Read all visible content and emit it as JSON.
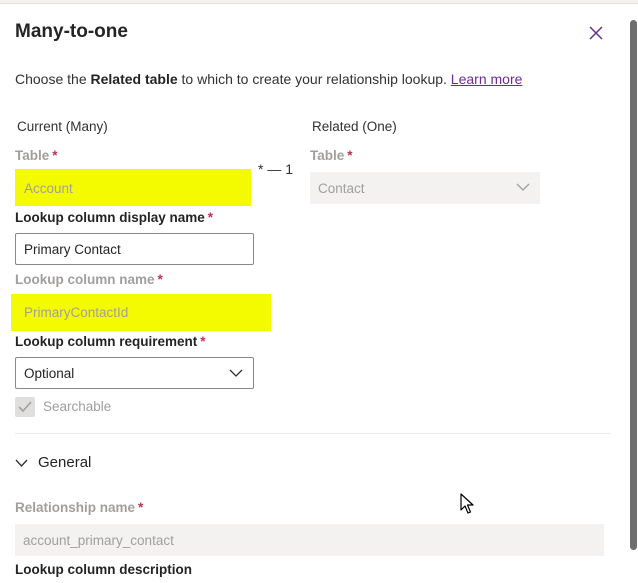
{
  "panel": {
    "title": "Many-to-one",
    "description_prefix": "Choose the ",
    "description_bold": "Related table",
    "description_suffix": " to which to create your relationship lookup. ",
    "learn_more": "Learn more"
  },
  "current": {
    "heading": "Current (Many)",
    "table_label": "Table",
    "table_value": "Account"
  },
  "related": {
    "heading": "Related (One)",
    "table_label": "Table",
    "table_value": "Contact"
  },
  "relationship_symbol": "* — 1",
  "lookup_display": {
    "label": "Lookup column display name",
    "value": "Primary Contact"
  },
  "lookup_name": {
    "label": "Lookup column name",
    "value": "PrimaryContactId"
  },
  "lookup_requirement": {
    "label": "Lookup column requirement",
    "value": "Optional"
  },
  "searchable": {
    "label": "Searchable",
    "checked": true
  },
  "general": {
    "label": "General"
  },
  "relationship_name": {
    "label": "Relationship name",
    "value": "account_primary_contact"
  },
  "lookup_description": {
    "label": "Lookup column description"
  },
  "required_mark": "*",
  "colors": {
    "highlight": "#f4fb00",
    "required": "#c4314b",
    "link": "#6b2c91",
    "disabled_text": "#a19f9d"
  }
}
